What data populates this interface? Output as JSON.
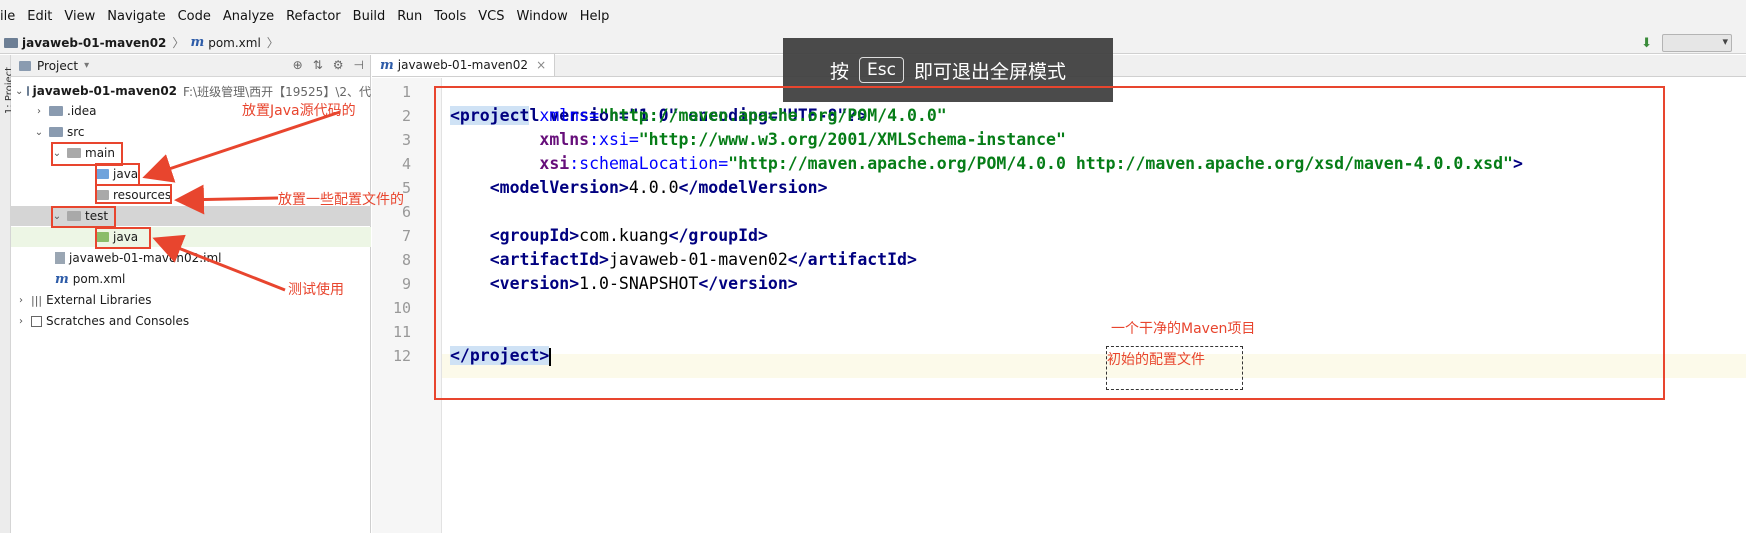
{
  "menu": [
    "ile",
    "Edit",
    "View",
    "Navigate",
    "Code",
    "Analyze",
    "Refactor",
    "Build",
    "Run",
    "Tools",
    "VCS",
    "Window",
    "Help"
  ],
  "navbar": {
    "project": "javaweb-01-maven02",
    "file": "pom.xml",
    "file_icon": "m"
  },
  "toolstrip": {
    "label": "1: Project"
  },
  "project_panel": {
    "title": "Project",
    "tree": [
      {
        "label": "javaweb-01-maven02",
        "extra": "F:\\班级管理\\西开【19525】\\2、代",
        "icon": "folder-icon"
      },
      {
        "label": ".idea",
        "icon": "folder-icon"
      },
      {
        "label": "src",
        "icon": "folder-icon"
      },
      {
        "label": "main",
        "icon": "folder-icon"
      },
      {
        "label": "java",
        "icon": "source-folder-icon"
      },
      {
        "label": "resources",
        "icon": "resources-folder-icon"
      },
      {
        "label": "test",
        "icon": "folder-icon"
      },
      {
        "label": "java",
        "icon": "test-folder-icon"
      },
      {
        "label": "javaweb-01-maven02.iml",
        "icon": "iml-file-icon"
      },
      {
        "label": "pom.xml",
        "icon": "maven-file-icon"
      },
      {
        "label": "External Libraries",
        "icon": "libraries-icon"
      },
      {
        "label": "Scratches and Consoles",
        "icon": "scratches-icon"
      }
    ]
  },
  "editor": {
    "tab": "javaweb-01-maven02",
    "line_numbers": [
      "1",
      "2",
      "3",
      "4",
      "5",
      "6",
      "7",
      "8",
      "9",
      "10",
      "11",
      "12"
    ],
    "code": {
      "l1": "<?xml version=\"1.0\" encoding=\"UTF-8\"?>",
      "l2_tag": "<project",
      "l2_attr": " xmlns=",
      "l2_val": "\"http://maven.apache.org/POM/4.0.0\"",
      "l3_ns": "xmlns",
      "l3_attr": ":xsi=",
      "l3_val": "\"http://www.w3.org/2001/XMLSchema-instance\"",
      "l4_ns": "xsi",
      "l4_attr": ":schemaLocation=",
      "l4_val": "\"http://maven.apache.org/POM/4.0.0 http://maven.apache.org/xsd/maven-4.0.0.xsd\"",
      "l4_end": ">",
      "l5_open": "<modelVersion>",
      "l5_text": "4.0.0",
      "l5_close": "</modelVersion>",
      "l7_open": "<groupId>",
      "l7_text": "com.kuang",
      "l7_close": "</groupId>",
      "l8_open": "<artifactId>",
      "l8_text": "javaweb-01-maven02",
      "l8_close": "</artifactId>",
      "l9_open": "<version>",
      "l9_text": "1.0-SNAPSHOT",
      "l9_close": "</version>",
      "l12": "</project>"
    }
  },
  "toast": {
    "prefix": "按",
    "key": "Esc",
    "suffix": "即可退出全屏模式"
  },
  "annotations": {
    "java_src": "放置Java源代码的",
    "resources": "放置一些配置文件的",
    "test": "测试使用",
    "clean_project": "一个干净的Maven项目",
    "initial_config": "初始的配置文件"
  },
  "colors": {
    "annotation": "#e8452e",
    "tag": "#000080",
    "value": "#067d17",
    "attr": "#0000ff"
  }
}
